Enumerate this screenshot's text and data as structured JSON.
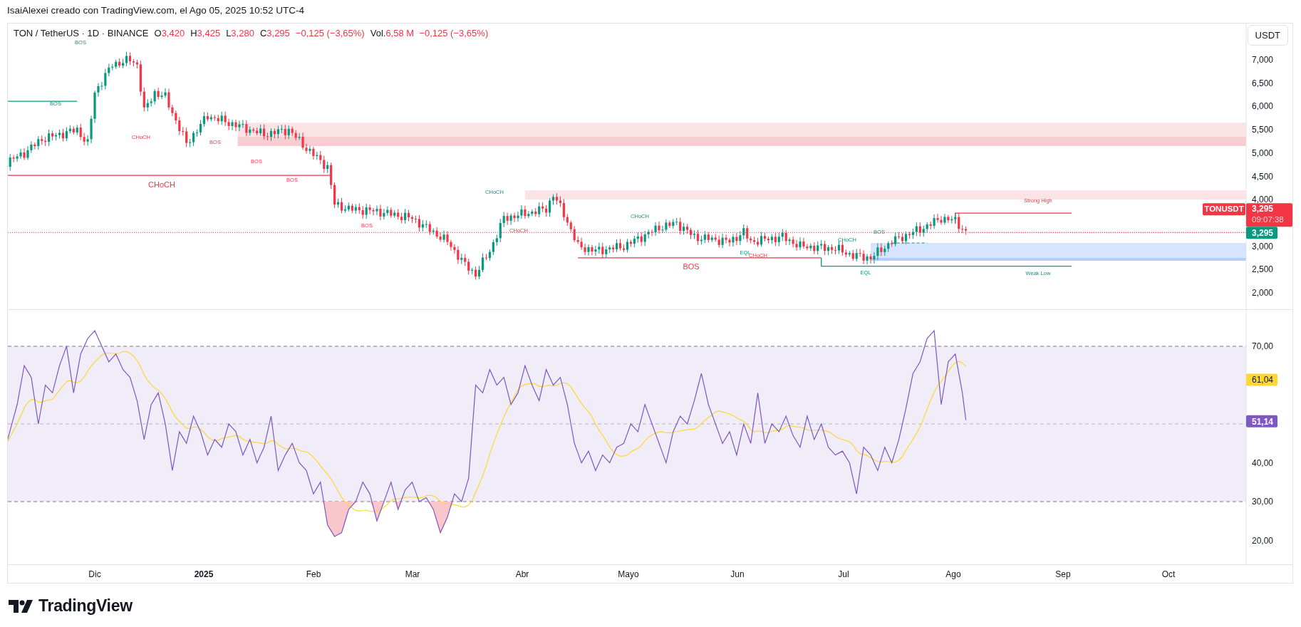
{
  "caption": "IsaiAlexei creado con TradingView.com, el Ago 05, 2025 10:52 UTC-4",
  "legend": {
    "symbol": "TON / TetherUS · 1D · BINANCE",
    "ohlc": [
      {
        "label": "O",
        "value": "3,420"
      },
      {
        "label": "H",
        "value": "3,425"
      },
      {
        "label": "L",
        "value": "3,280"
      },
      {
        "label": "C",
        "value": "3,295"
      }
    ],
    "change": "−0,125 (−3,65%)",
    "volume": {
      "label": "Vol.",
      "value": "6,58 M",
      "change": "−0,125 (−3,65%)"
    }
  },
  "currency_button": "USDT",
  "price_axis": [
    "7,000",
    "6,500",
    "6,000",
    "5,500",
    "5,000",
    "4,500",
    "4,000",
    "3,000",
    "2,500",
    "2,000"
  ],
  "price_badges": {
    "symbol": "TONUSDT",
    "price": "3,295",
    "countdown": "09:07:38",
    "last_close": "3,295"
  },
  "annotations": [
    {
      "text": "BOS",
      "kind": "bullish"
    },
    {
      "text": "BOS",
      "kind": "bullish"
    },
    {
      "text": "CHoCH",
      "kind": "bearish"
    },
    {
      "text": "BOS",
      "kind": "bearish"
    },
    {
      "text": "BOS",
      "kind": "bearish"
    },
    {
      "text": "BOS",
      "kind": "bearish"
    },
    {
      "text": "CHoCH",
      "kind": "bearish"
    },
    {
      "text": "BOS",
      "kind": "bearish"
    },
    {
      "text": "CHoCH",
      "kind": "bullish"
    },
    {
      "text": "CHoCH",
      "kind": "bearish"
    },
    {
      "text": "CHoCH",
      "kind": "bullish"
    },
    {
      "text": "BOS",
      "kind": "bearish"
    },
    {
      "text": "EQL",
      "kind": "bullish"
    },
    {
      "text": "CHoCH",
      "kind": "bearish"
    },
    {
      "text": "CHoCH",
      "kind": "bullish"
    },
    {
      "text": "BOS",
      "kind": "bullish"
    },
    {
      "text": "EQL",
      "kind": "bullish"
    },
    {
      "text": "Strong High",
      "kind": "bearish"
    },
    {
      "text": "Weak Low",
      "kind": "bullish"
    }
  ],
  "rsi_axis": [
    "70,00",
    "40,00",
    "30,00",
    "20,00"
  ],
  "rsi_badges": {
    "ma_value": "61,04",
    "rsi_value": "51,14"
  },
  "time_axis": [
    {
      "label": "Dic",
      "kind": "month"
    },
    {
      "label": "2025",
      "kind": "year"
    },
    {
      "label": "Feb",
      "kind": "month"
    },
    {
      "label": "Mar",
      "kind": "month"
    },
    {
      "label": "Abr",
      "kind": "month"
    },
    {
      "label": "Mayo",
      "kind": "month"
    },
    {
      "label": "Jun",
      "kind": "month"
    },
    {
      "label": "Jul",
      "kind": "month"
    },
    {
      "label": "Ago",
      "kind": "month"
    },
    {
      "label": "Sep",
      "kind": "month"
    },
    {
      "label": "Oct",
      "kind": "month"
    }
  ],
  "brand": "TradingView"
}
